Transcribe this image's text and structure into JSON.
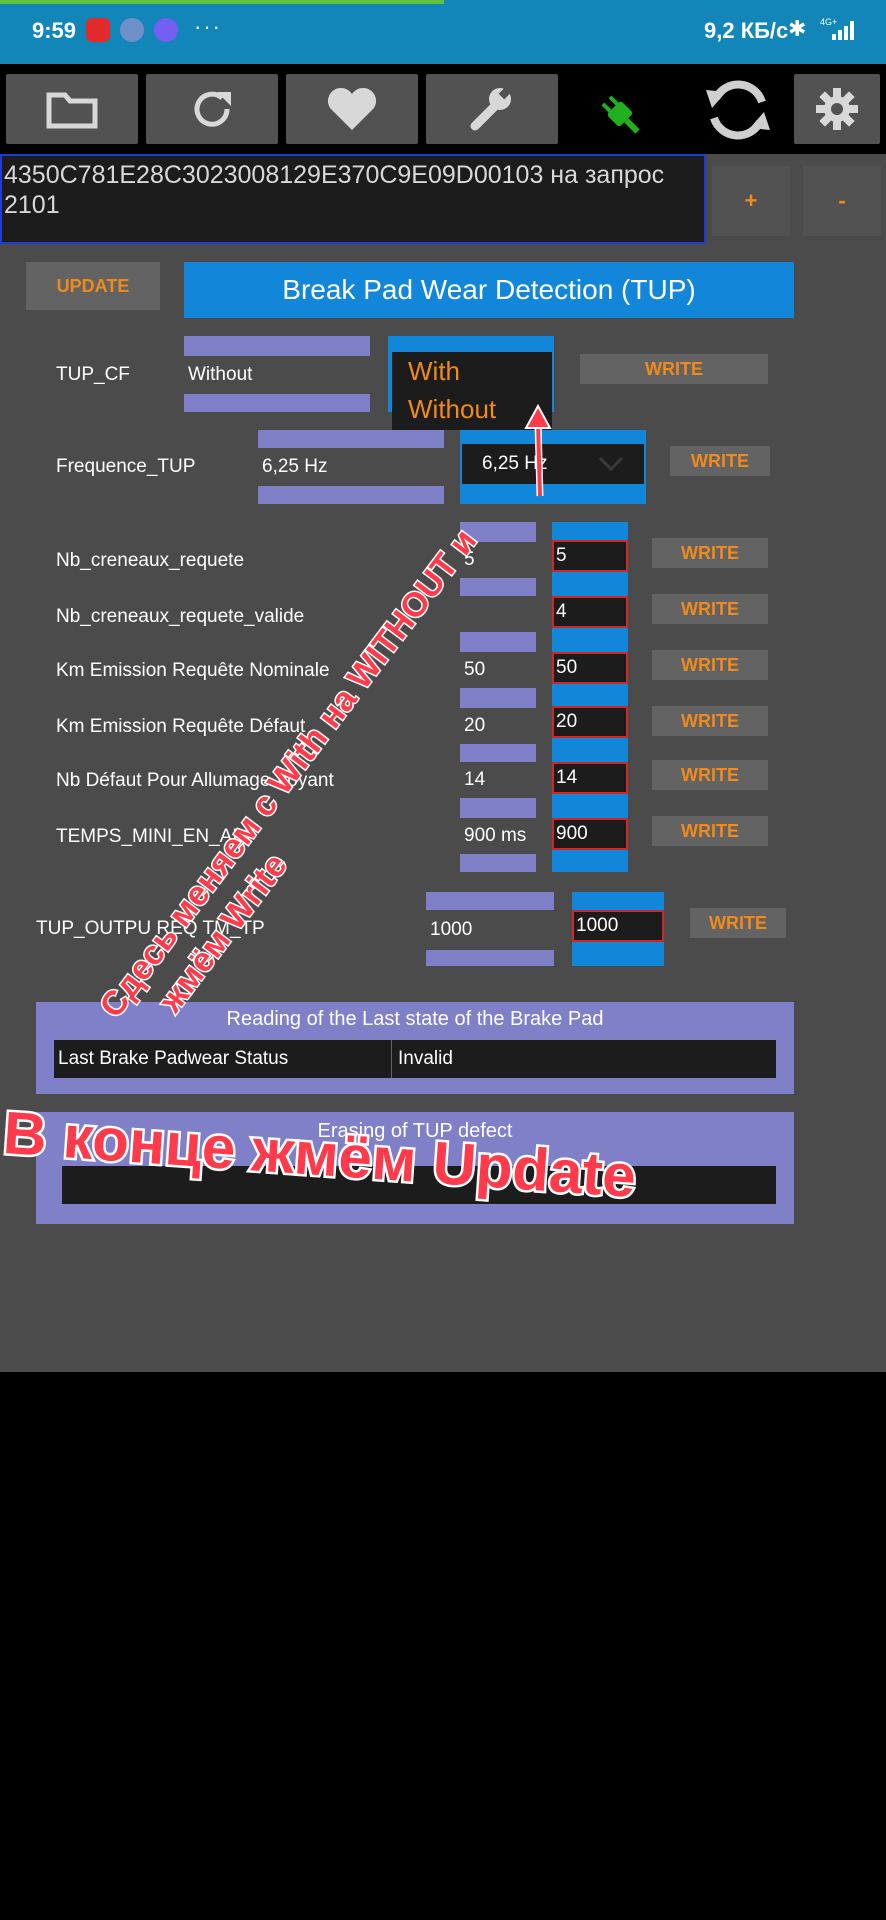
{
  "status_bar": {
    "time": "9:59",
    "dots": "···",
    "speed": "9,2 КБ/с",
    "network": "4G+"
  },
  "toolbar": {
    "icons": [
      "folder-icon",
      "refresh-icon",
      "heart-icon",
      "wrench-icon",
      "plug-icon",
      "sync-icon",
      "gear-icon"
    ]
  },
  "request": {
    "text": "4350C781E28C3023008129E370C9E09D00103 на запрос 2101",
    "plus_label": "+",
    "minus_label": "-"
  },
  "update_label": "UPDATE",
  "section_title": "Break Pad Wear Detection (TUP)",
  "tup_cf": {
    "label": "TUP_CF",
    "current": "Without",
    "options": [
      "With",
      "Without"
    ],
    "write_label": "WRITE"
  },
  "frequence": {
    "label": "Frequence_TUP",
    "current": "6,25 Hz",
    "selected": "6,25 Hz",
    "write_label": "WRITE"
  },
  "params": [
    {
      "label": "Nb_creneaux_requete",
      "current": "5",
      "edit": "5",
      "write_label": "WRITE"
    },
    {
      "label": "Nb_creneaux_requete_valide",
      "current": "",
      "edit": "4",
      "write_label": "WRITE"
    },
    {
      "label": "Km Emission Requête Nominale",
      "current": "50",
      "edit": "50",
      "write_label": "WRITE"
    },
    {
      "label": "Km Emission Requête Défaut",
      "current": "20",
      "edit": "20",
      "write_label": "WRITE"
    },
    {
      "label": "Nb Défaut Pour Allumage Voyant",
      "current": "14",
      "edit": "14",
      "write_label": "WRITE"
    },
    {
      "label": "TEMPS_MINI_EN_AL",
      "current": "900 ms",
      "edit": "900",
      "write_label": "WRITE"
    }
  ],
  "tup_output": {
    "label": "TUP_OUTPU  REQ  TM_TP",
    "current": "1000",
    "edit": "1000",
    "write_label": "WRITE"
  },
  "reading_panel": {
    "title": "Reading of the Last state of the Brake Pad",
    "row_label": "Last Brake Padwear Status",
    "row_value": "Invalid"
  },
  "erasing_panel": {
    "title": "Erasing of TUP defect"
  },
  "annotations": {
    "diagonal_line1": "Сдесь меняем с With  на WITHOUT и",
    "diagonal_line2": "жмём Write",
    "bottom": "В конце жмём Update"
  },
  "colors": {
    "accent_orange": "#f08a1c",
    "blue": "#1286d8",
    "periwinkle": "#8080c8",
    "annotation_red": "#ff3a4a",
    "status_bar": "#1286b8"
  }
}
